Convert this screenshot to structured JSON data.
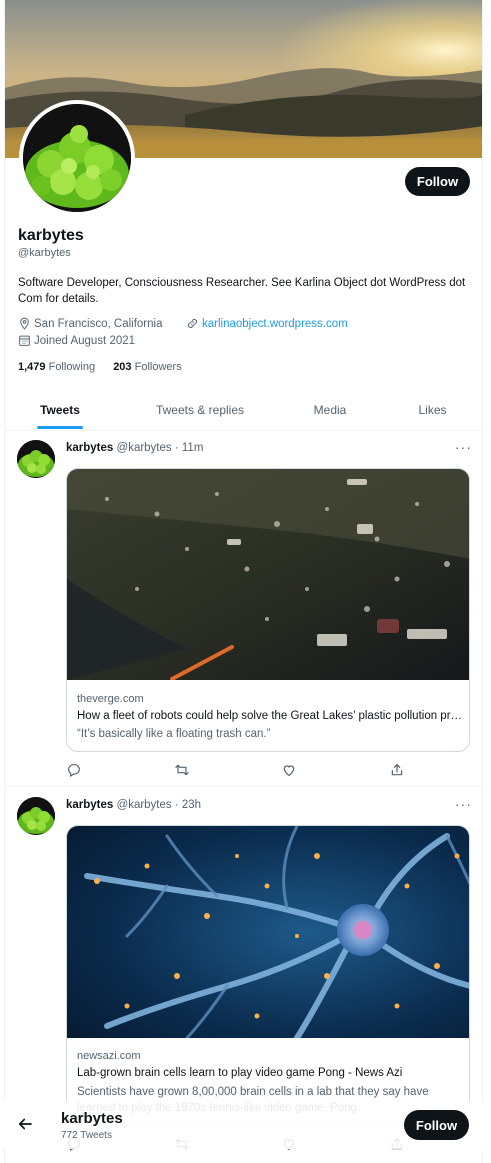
{
  "profile": {
    "name": "karbytes",
    "handle": "@karbytes",
    "bio": "Software Developer, Consciousness Researcher. See Karlina Object dot WordPress dot Com for details.",
    "location": "San Francisco, California",
    "website": "karlinaobject.wordpress.com",
    "joined": "Joined August 2021",
    "following_count": "1,479",
    "following_label": "Following",
    "followers_count": "203",
    "followers_label": "Followers",
    "follow_label": "Follow"
  },
  "tabs": [
    {
      "label": "Tweets",
      "active": true
    },
    {
      "label": "Tweets & replies",
      "active": false
    },
    {
      "label": "Media",
      "active": false
    },
    {
      "label": "Likes",
      "active": false
    }
  ],
  "tweets": [
    {
      "name": "karbytes",
      "handle": "@karbytes",
      "time": "· 11m",
      "more": "···",
      "card": {
        "domain": "theverge.com",
        "title": "How a fleet of robots could help solve the Great Lakes’ plastic pollution problem",
        "desc": "“It’s basically like a floating trash can.”"
      }
    },
    {
      "name": "karbytes",
      "handle": "@karbytes",
      "time": "· 23h",
      "more": "···",
      "card": {
        "domain": "newsazi.com",
        "title": "Lab-grown brain cells learn to play video game Pong - News Azi",
        "desc": "Scientists have grown 8,00,000 brain cells in a lab that they say have learned to play the 1970s tennis-like video game, Pong."
      }
    }
  ],
  "bottom_bar": {
    "name": "karbytes",
    "tweet_count": "772 Tweets",
    "follow_label": "Follow"
  },
  "icons": {
    "location": "map-pin-icon",
    "link": "link-icon",
    "calendar": "calendar-icon",
    "reply": "reply-icon",
    "retweet": "retweet-icon",
    "like": "heart-icon",
    "share": "share-icon",
    "back": "back-arrow-icon"
  },
  "colors": {
    "accent": "#1d9bf0",
    "text": "#0f1419",
    "muted": "#536471",
    "border": "#cfd9de"
  }
}
